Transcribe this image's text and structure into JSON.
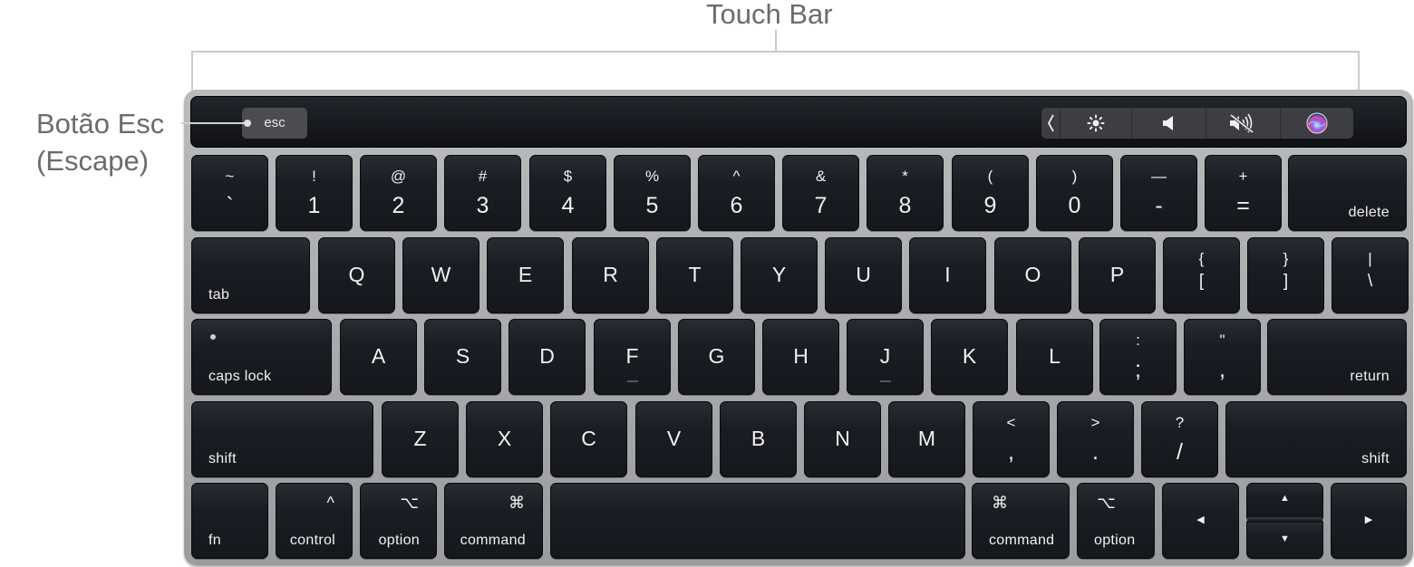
{
  "callouts": {
    "touch_bar": "Touch Bar",
    "esc_line1": "Botão Esc",
    "esc_line2": "(Escape)"
  },
  "touch_bar": {
    "esc_label": "esc",
    "control_strip": [
      {
        "icon": "chevron-left-icon",
        "glyph": "❮"
      },
      {
        "icon": "brightness-icon",
        "glyph": "☼"
      },
      {
        "icon": "volume-icon",
        "glyph": "🔈"
      },
      {
        "icon": "mute-icon",
        "glyph": "🔇"
      },
      {
        "icon": "siri-icon",
        "glyph": ""
      }
    ]
  },
  "keyboard": {
    "number_row": [
      {
        "top": "~",
        "bottom": "`"
      },
      {
        "top": "!",
        "bottom": "1"
      },
      {
        "top": "@",
        "bottom": "2"
      },
      {
        "top": "#",
        "bottom": "3"
      },
      {
        "top": "$",
        "bottom": "4"
      },
      {
        "top": "%",
        "bottom": "5"
      },
      {
        "top": "^",
        "bottom": "6"
      },
      {
        "top": "&",
        "bottom": "7"
      },
      {
        "top": "*",
        "bottom": "8"
      },
      {
        "top": "(",
        "bottom": "9"
      },
      {
        "top": ")",
        "bottom": "0"
      },
      {
        "top": "—",
        "bottom": "-"
      },
      {
        "top": "+",
        "bottom": "="
      }
    ],
    "delete": "delete",
    "tab": "tab",
    "qwerty_row": [
      "Q",
      "W",
      "E",
      "R",
      "T",
      "Y",
      "U",
      "I",
      "O",
      "P"
    ],
    "bracket_keys": [
      {
        "top": "{",
        "bottom": "["
      },
      {
        "top": "}",
        "bottom": "]"
      },
      {
        "top": "|",
        "bottom": "\\"
      }
    ],
    "caps_lock": "caps lock",
    "home_row": [
      "A",
      "S",
      "D",
      "F",
      "G",
      "H",
      "J",
      "K",
      "L"
    ],
    "semicolon_keys": [
      {
        "top": ":",
        "bottom": ";"
      },
      {
        "top": "\"",
        "bottom": ","
      }
    ],
    "return": "return",
    "shift": "shift",
    "bottom_letter_row": [
      "Z",
      "X",
      "C",
      "V",
      "B",
      "N",
      "M"
    ],
    "punct_keys": [
      {
        "top": "<",
        "bottom": ","
      },
      {
        "top": ">",
        "bottom": "."
      },
      {
        "top": "?",
        "bottom": "/"
      }
    ],
    "fn": "fn",
    "control": {
      "label": "control",
      "symbol": "^"
    },
    "option": {
      "label": "option",
      "symbol": "⌥"
    },
    "command": {
      "label": "command",
      "symbol": "⌘"
    },
    "arrows": {
      "left": "◀",
      "up": "▲",
      "down": "▼",
      "right": "▶"
    }
  }
}
